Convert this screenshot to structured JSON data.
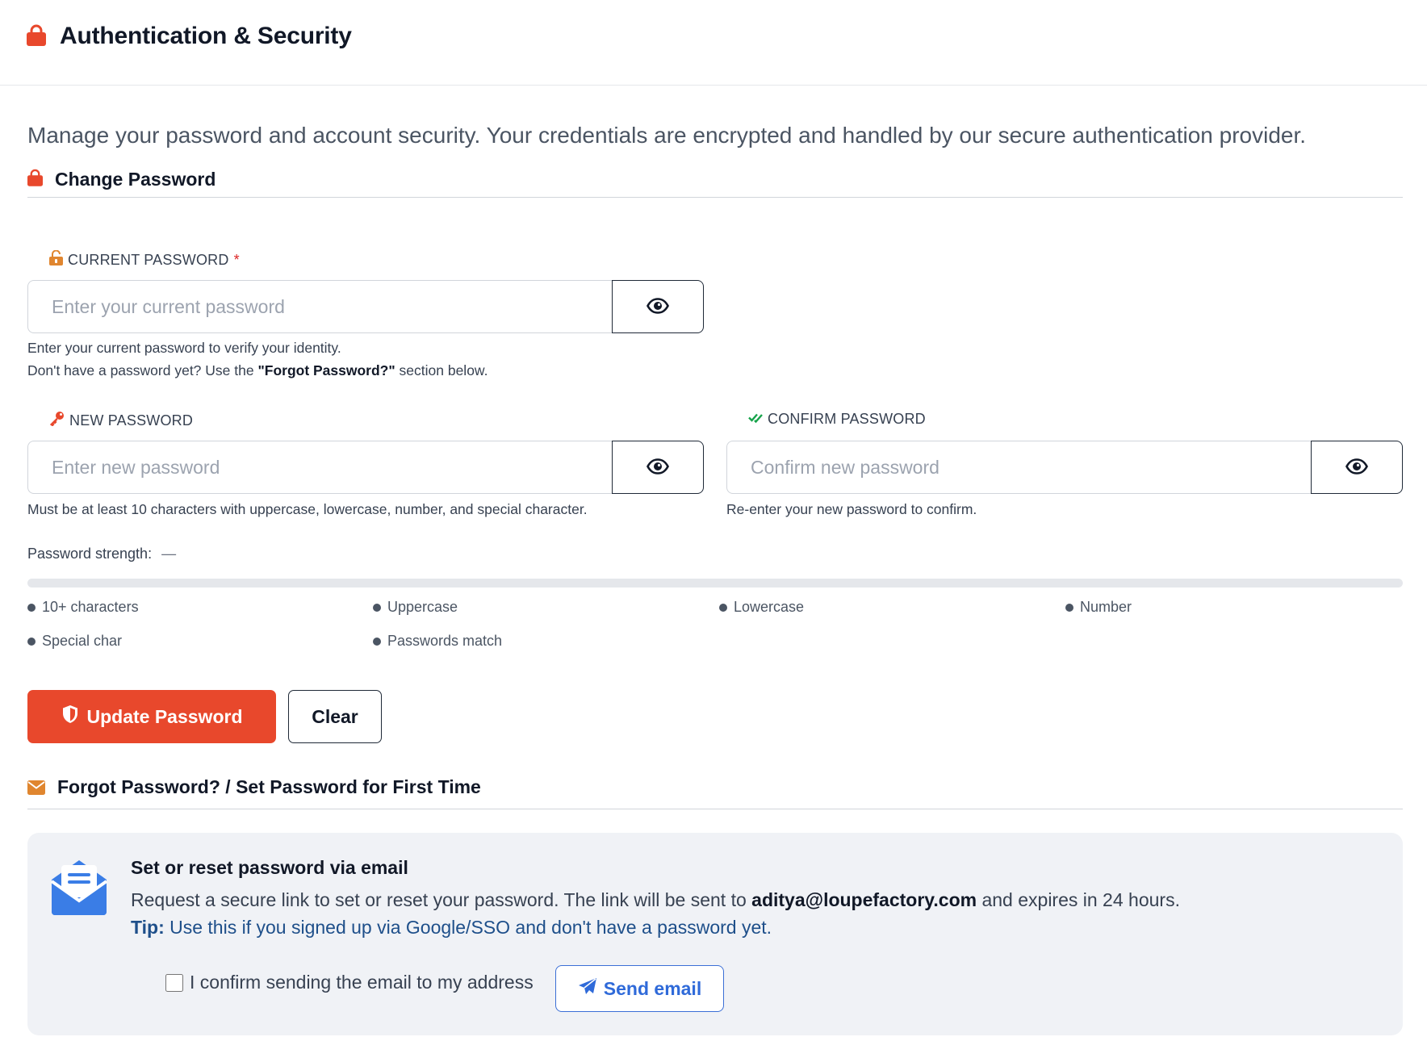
{
  "header": {
    "title": "Authentication & Security",
    "icon": "lock-icon"
  },
  "intro": "Manage your password and account security. Your credentials are encrypted and handled by our secure authentication provider.",
  "change_password": {
    "title": "Change Password",
    "current": {
      "label": "CURRENT PASSWORD",
      "required_mark": "*",
      "placeholder": "Enter your current password",
      "value": "",
      "help_line1": "Enter your current password to verify your identity.",
      "help_line2_pre": "Don't have a password yet? Use the ",
      "help_line2_bold": "\"Forgot Password?\"",
      "help_line2_post": " section below."
    },
    "new": {
      "label": "NEW PASSWORD",
      "placeholder": "Enter new password",
      "value": "",
      "help": "Must be at least 10 characters with uppercase, lowercase, number, and special character."
    },
    "confirm": {
      "label": "CONFIRM PASSWORD",
      "placeholder": "Confirm new password",
      "value": "",
      "help": "Re-enter your new password to confirm."
    },
    "strength": {
      "label": "Password strength:",
      "value_text": "—",
      "level": 0
    },
    "requirements": [
      "10+ characters",
      "Uppercase",
      "Lowercase",
      "Number",
      "Special char",
      "Passwords match"
    ],
    "update_label": "Update Password",
    "clear_label": "Clear"
  },
  "forgot": {
    "title": "Forgot Password? / Set Password for First Time",
    "card_title": "Set or reset password via email",
    "desc_pre": "Request a secure link to set or reset your password. The link will be sent to ",
    "email": "aditya@loupefactory.com",
    "desc_post": " and expires in 24 hours.",
    "tip_label": "Tip:",
    "tip_text": " Use this if you signed up via Google/SSO and don't have a password yet.",
    "confirm_label": "I confirm sending the email to my address",
    "confirm_checked": false,
    "send_label": "Send email"
  },
  "colors": {
    "accent": "#e8482c",
    "link_blue": "#2f6ad9",
    "tip_blue": "#1e4f8a",
    "check_green": "#16a34a",
    "key_orange": "#e8482c",
    "mail_orange": "#e0862f"
  }
}
